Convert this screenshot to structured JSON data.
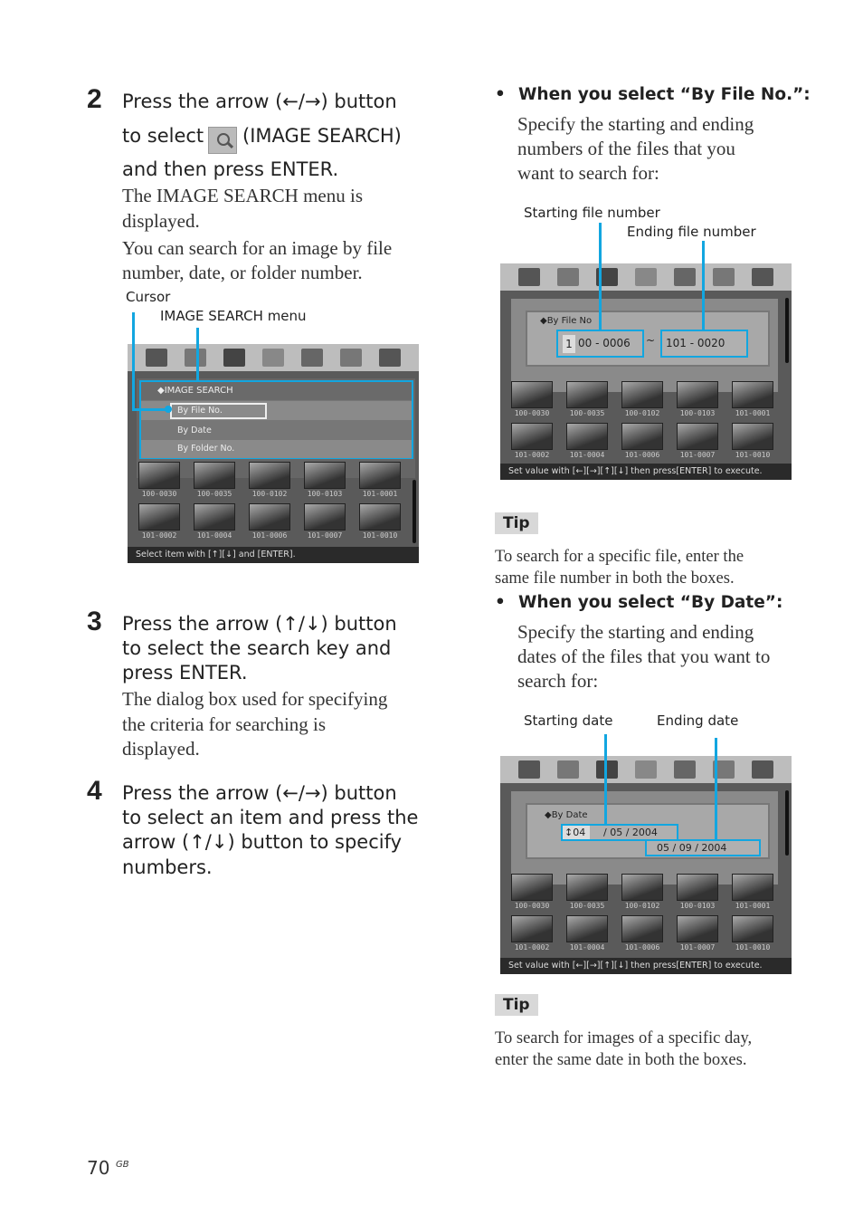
{
  "step2": {
    "number": "2",
    "heading_line1": "Press the arrow (←/→) button",
    "heading_line2a": "to select",
    "heading_line2b": "(IMAGE SEARCH)",
    "heading_line3": "and then press ENTER.",
    "body": [
      "The IMAGE SEARCH menu is",
      "displayed.",
      "You can search for an image by file",
      "number, date, or folder number."
    ],
    "callout_cursor": "Cursor",
    "callout_menu": "IMAGE SEARCH menu"
  },
  "step3": {
    "number": "3",
    "heading": [
      "Press the arrow (↑/↓) button",
      "to select the search key and",
      "press ENTER."
    ],
    "body": [
      "The dialog box used for specifying",
      "the criteria for searching is",
      "displayed."
    ]
  },
  "step4": {
    "number": "4",
    "heading": [
      "Press the arrow (←/→) button",
      "to select an item and press the",
      "arrow (↑/↓) button to specify",
      "numbers."
    ]
  },
  "screen1": {
    "menu_title": "◆IMAGE SEARCH",
    "items": [
      "By File No.",
      "By Date",
      "By Folder No."
    ],
    "selected": "By File No.",
    "status": "Select item with [↑][↓] and [ENTER]."
  },
  "byfile": {
    "bullet": "•",
    "heading": "When you select “By File No.”:",
    "body": [
      "Specify the starting and ending",
      "numbers of the files that you",
      "want to search for:"
    ],
    "callout_start": "Starting file number",
    "callout_end": "Ending file number",
    "dialog_title": "◆By File No",
    "start_value": "00 - 0006",
    "start_digit": "1",
    "separator": "~",
    "end_value": "101  -  0020",
    "status": "Set value with [←][→][↑][↓] then press[ENTER] to execute."
  },
  "tip1": {
    "label": "Tip",
    "text": [
      "To search for a specific file, enter the",
      "same file number in both the boxes."
    ]
  },
  "bydate": {
    "bullet": "•",
    "heading": "When you select “By Date”:",
    "body": [
      "Specify the starting and ending",
      "dates of the files that you want to",
      "search for:"
    ],
    "callout_start": "Starting date",
    "callout_end": "Ending date",
    "dialog_title": "◆By Date",
    "start_month": "↕04",
    "start_rest": "/ 05 / 2004",
    "end_value": "05 / 09 / 2004",
    "status": "Set value with [←][→][↑][↓] then press[ENTER] to execute."
  },
  "tip2": {
    "label": "Tip",
    "text": [
      "To search for images of a specific day,",
      "enter the same date in both the boxes."
    ]
  },
  "thumbnails": [
    "100-0030",
    "100-0035",
    "100-0102",
    "100-0103",
    "101-0001",
    "101-0002",
    "101-0004",
    "101-0006",
    "101-0007",
    "101-0010"
  ],
  "toolbar_icons": [
    "image-edit-icon",
    "slideshow-icon",
    "image-search-icon",
    "toolbox-icon",
    "copy-icon",
    "trash-icon",
    "zoom-icon"
  ],
  "footer": {
    "page": "70",
    "region": "GB"
  },
  "colors": {
    "callout": "#12a6e0",
    "toolbar": "#bdbdbd",
    "screen_bg": "#5a5a5a"
  }
}
